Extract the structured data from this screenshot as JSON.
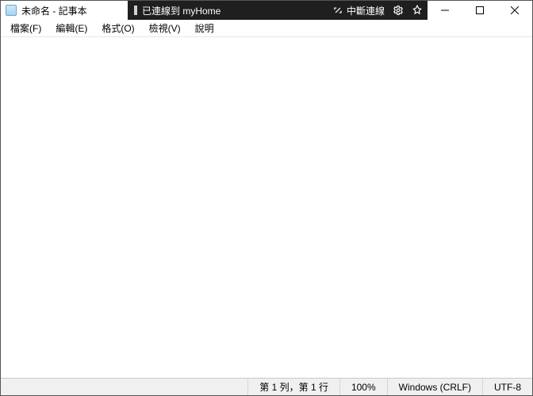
{
  "titlebar": {
    "app_title": "未命名 - 記事本",
    "remote_status": "已連線到 myHome",
    "disconnect_label": "中斷連線"
  },
  "menubar": {
    "file": "檔案(F)",
    "edit": "編輯(E)",
    "format": "格式(O)",
    "view": "檢視(V)",
    "help": "說明"
  },
  "editor": {
    "content": ""
  },
  "statusbar": {
    "position": "第 1 列，第 1 行",
    "zoom": "100%",
    "line_ending": "Windows (CRLF)",
    "encoding": "UTF-8"
  }
}
